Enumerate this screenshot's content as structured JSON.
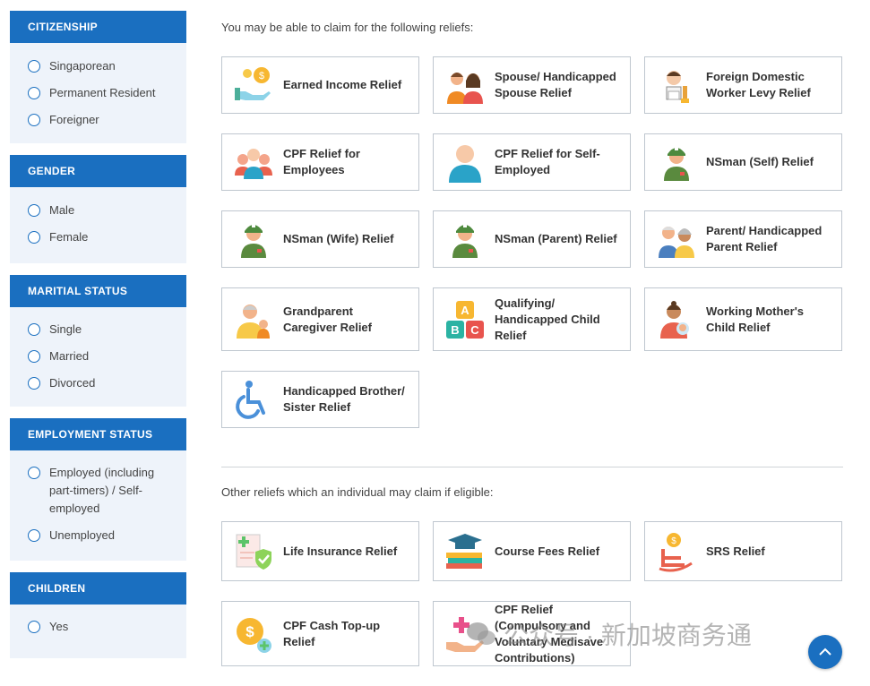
{
  "sidebar": {
    "groups": [
      {
        "title": "CITIZENSHIP",
        "options": [
          "Singaporean",
          "Permanent Resident",
          "Foreigner"
        ]
      },
      {
        "title": "GENDER",
        "options": [
          "Male",
          "Female"
        ]
      },
      {
        "title": "MARITIAL STATUS",
        "options": [
          "Single",
          "Married",
          "Divorced"
        ]
      },
      {
        "title": "EMPLOYMENT STATUS",
        "options": [
          "Employed (including part-timers) / Self-employed",
          "Unemployed"
        ]
      },
      {
        "title": "CHILDREN",
        "options": [
          "Yes"
        ]
      }
    ]
  },
  "main": {
    "section1_title": "You may be able to claim for the following reliefs:",
    "reliefs": [
      {
        "label": "Earned Income Relief",
        "icon": "hand-coins-icon"
      },
      {
        "label": "Spouse/ Handicapped Spouse Relief",
        "icon": "couple-icon"
      },
      {
        "label": "Foreign Domestic Worker Levy Relief",
        "icon": "domestic-worker-icon"
      },
      {
        "label": "CPF Relief for Employees",
        "icon": "employees-group-icon"
      },
      {
        "label": "CPF Relief for Self-Employed",
        "icon": "person-icon"
      },
      {
        "label": "NSman (Self) Relief",
        "icon": "soldier-icon"
      },
      {
        "label": "NSman (Wife) Relief",
        "icon": "soldier-icon"
      },
      {
        "label": "NSman (Parent) Relief",
        "icon": "soldier-icon"
      },
      {
        "label": "Parent/ Handicapped Parent Relief",
        "icon": "elderly-couple-icon"
      },
      {
        "label": "Grandparent Caregiver Relief",
        "icon": "grandparent-child-icon"
      },
      {
        "label": "Qualifying/ Handicapped Child Relief",
        "icon": "abc-blocks-icon"
      },
      {
        "label": "Working Mother's Child Relief",
        "icon": "mother-baby-icon"
      },
      {
        "label": "Handicapped Brother/ Sister Relief",
        "icon": "wheelchair-icon"
      }
    ],
    "section2_title": "Other reliefs which an individual may claim if eligible:",
    "other_reliefs": [
      {
        "label": "Life Insurance Relief",
        "icon": "insurance-shield-icon"
      },
      {
        "label": "Course Fees Relief",
        "icon": "graduation-books-icon"
      },
      {
        "label": "SRS Relief",
        "icon": "rocking-chair-coin-icon"
      },
      {
        "label": "CPF Cash Top-up Relief",
        "icon": "coin-plus-icon"
      },
      {
        "label": "CPF Relief (Compulsory and Voluntary Medisave Contributions)",
        "icon": "medical-hand-icon"
      }
    ]
  },
  "watermark": {
    "text": "公众号 · 新加坡商务通"
  },
  "scroll_top": {
    "icon": "chevron-up-icon"
  },
  "colors": {
    "accent": "#1a6fc0",
    "sidebar_bg": "#eef3fa",
    "card_border": "#bfc7cf"
  }
}
